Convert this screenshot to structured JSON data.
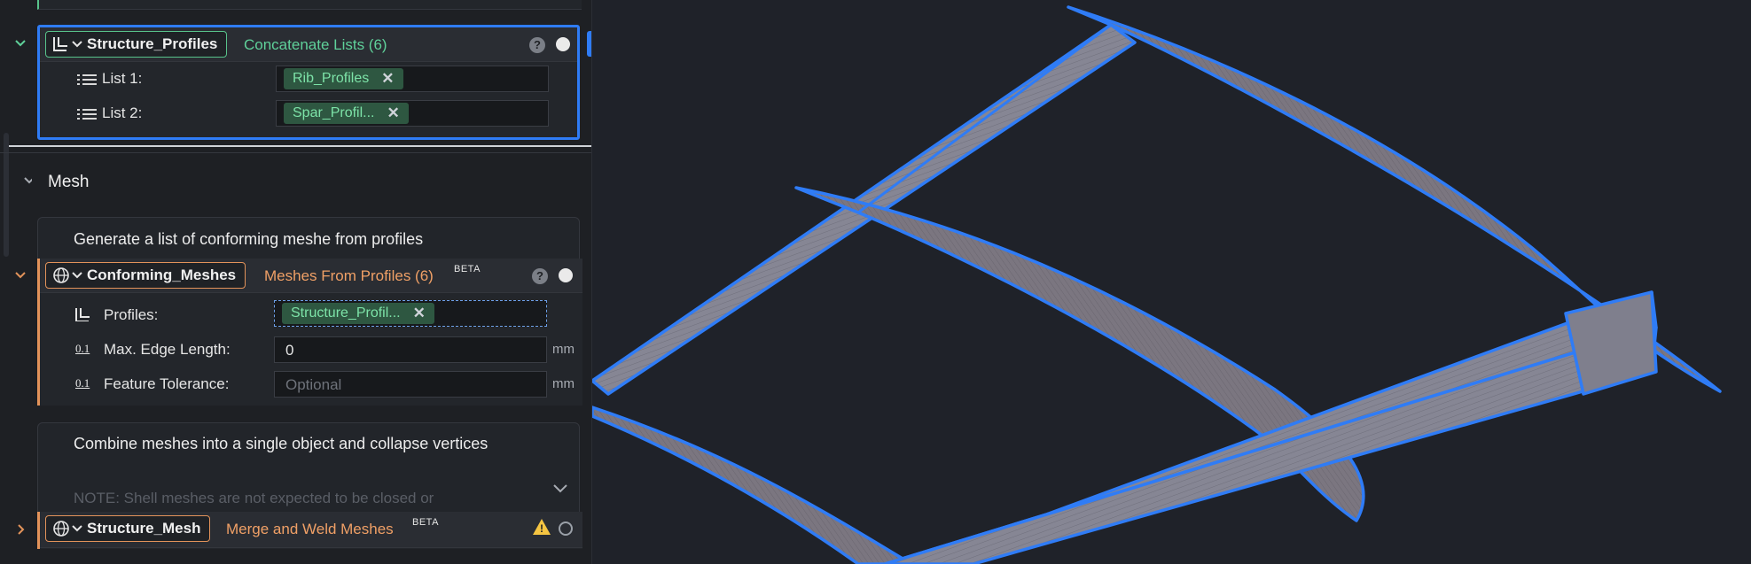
{
  "structure_profiles": {
    "name": "Structure_Profiles",
    "operation": "Concatenate Lists (6)",
    "help": "?",
    "rows": [
      {
        "label": "List 1:",
        "tag": "Rib_Profiles",
        "remove": "✕"
      },
      {
        "label": "List 2:",
        "tag": "Spar_Profil...",
        "remove": "✕"
      }
    ],
    "add_button": "+"
  },
  "mesh_section": {
    "title": "Mesh"
  },
  "conforming_meshes": {
    "comment": "Generate a list of conforming meshe from profiles",
    "name": "Conforming_Meshes",
    "operation": "Meshes From Profiles (6)",
    "badge": "BETA",
    "help": "?",
    "profiles_label": "Profiles:",
    "profiles_tag": "Structure_Profil...",
    "profiles_remove": "✕",
    "max_edge_label": "Max. Edge Length:",
    "max_edge_value": "0",
    "max_edge_unit": "mm",
    "feature_tol_label": "Feature Tolerance:",
    "feature_tol_placeholder": "Optional",
    "feature_tol_unit": "mm",
    "number_icon_text": "0.1"
  },
  "structure_mesh": {
    "comment": "Combine meshes into a single object and collapse vertices",
    "note": "NOTE: Shell meshes are not expected to be closed or",
    "name": "Structure_Mesh",
    "operation": "Merge and Weld Meshes",
    "badge": "BETA",
    "warning": "!"
  },
  "colors": {
    "accent_blue": "#2f7cf6",
    "green": "#5fd19a",
    "orange": "#f0a066",
    "surface": "#7a7680"
  }
}
